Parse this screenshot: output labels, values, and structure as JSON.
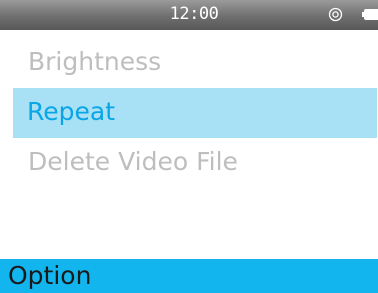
{
  "status_bar": {
    "time": "12:00",
    "icons": [
      "target-icon",
      "battery-icon"
    ]
  },
  "menu": {
    "items": [
      {
        "label": "Brightness",
        "selected": false
      },
      {
        "label": "Repeat",
        "selected": true
      },
      {
        "label": "Delete Video File",
        "selected": false
      }
    ]
  },
  "title_bar": {
    "label": "Option"
  },
  "colors": {
    "status_bar": "#6f6f6f",
    "selection_background": "#a8e1f6",
    "selection_text": "#0aa5e6",
    "inactive_text": "#bebebe",
    "title_bar": "#13b5ee",
    "title_text": "#1a1a1a"
  }
}
